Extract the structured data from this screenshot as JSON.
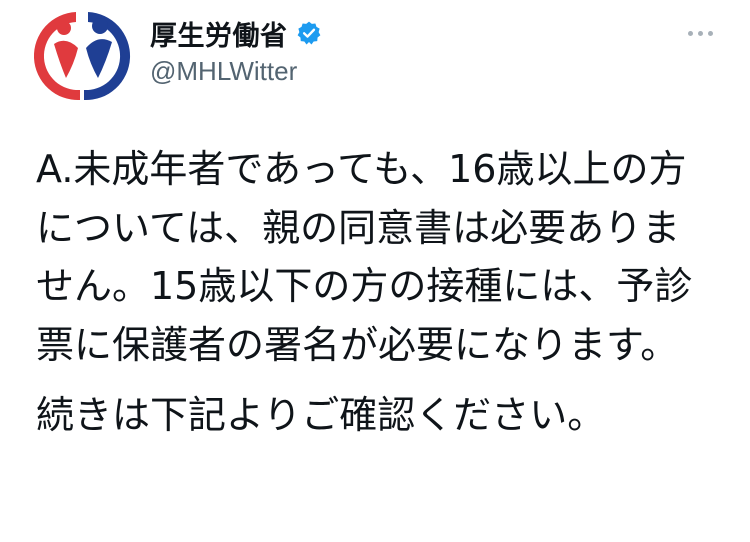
{
  "account": {
    "display_name": "厚生労働省",
    "handle": "@MHLWitter",
    "verified": true,
    "logo": "mhlw-logo",
    "colors": {
      "logo_red": "#e03a3e",
      "logo_blue": "#1f3f94",
      "verified_blue": "#1d9bf0"
    }
  },
  "menu": {
    "icon": "more-options-icon"
  },
  "tweet": {
    "paragraphs": [
      "A.未成年者であっても、16歳以上の方については、親の同意書は必要ありません。15歳以下の方の接種には、予診票に保護者の署名が必要になります。",
      "続きは下記よりご確認ください。"
    ]
  }
}
